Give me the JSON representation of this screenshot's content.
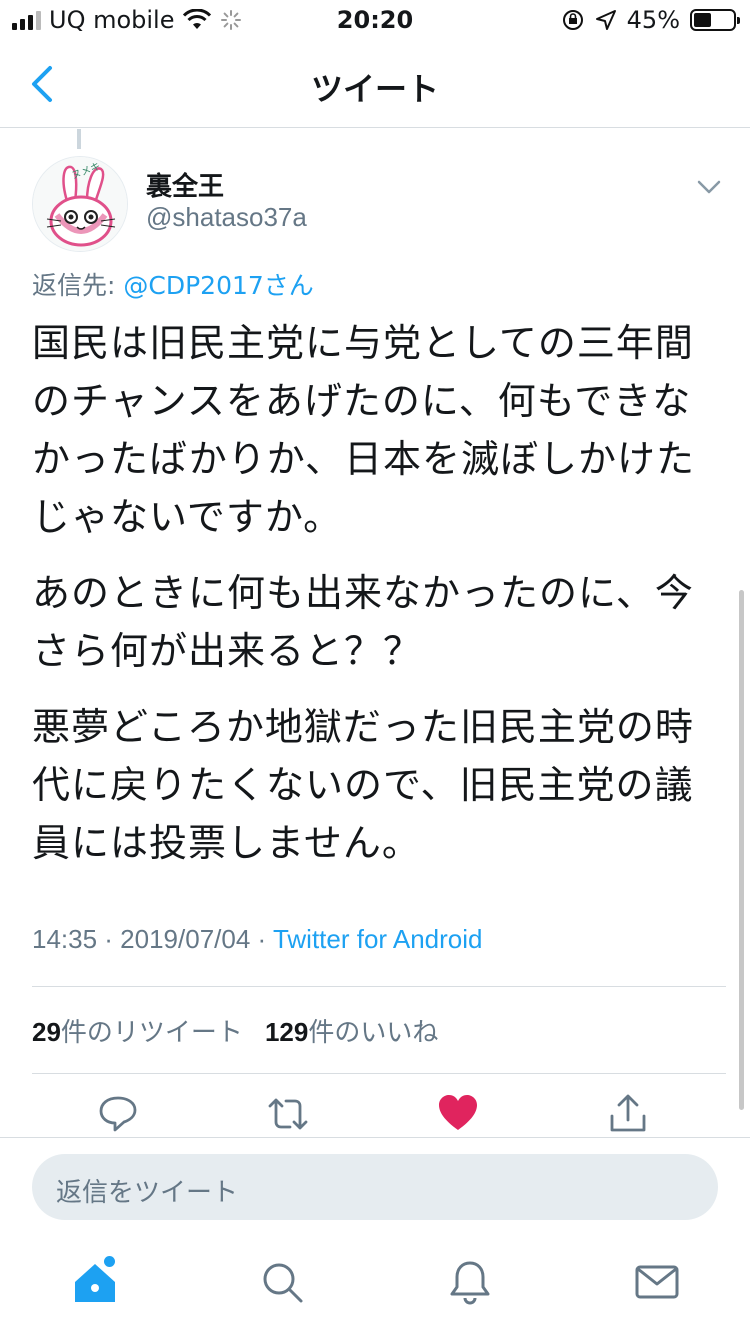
{
  "status_bar": {
    "carrier": "UQ mobile",
    "time": "20:20",
    "battery": "45%",
    "battery_level": 0.45
  },
  "nav": {
    "title": "ツイート"
  },
  "tweet": {
    "avatar_text": "ヌメキ",
    "display_name": "裏全王",
    "handle": "@shataso37a",
    "reply_prefix": "返信先: ",
    "reply_mention": "@CDP2017さん",
    "paragraphs": [
      "国民は旧民主党に与党としての三年間のチャンスをあげたのに、何もできなかったばかりか、日本を滅ぼしかけたじゃないですか。",
      "あのときに何も出来なかったのに、今さら何が出来ると？？",
      "悪夢どころか地獄だった旧民主党の時代に戻りたくないので、旧民主党の議員には投票しません。"
    ],
    "timestamp": "14:35 · 2019/07/04 · ",
    "source": "Twitter for Android",
    "retweet_count": "29",
    "retweet_label": "件のリツイート",
    "like_count": "129",
    "like_label": "件のいいね"
  },
  "colors": {
    "accent": "#1da1f2",
    "like": "#e0245e",
    "secondary_text": "#657786"
  },
  "reply_box": {
    "placeholder": "返信をツイート"
  },
  "icons": {
    "back": "chevron-left-icon",
    "caret": "chevron-down-icon",
    "reply": "reply-icon",
    "retweet": "retweet-icon",
    "like": "heart-icon",
    "share": "share-icon",
    "home": "home-icon",
    "search": "search-icon",
    "notifications": "bell-icon",
    "messages": "mail-icon"
  }
}
